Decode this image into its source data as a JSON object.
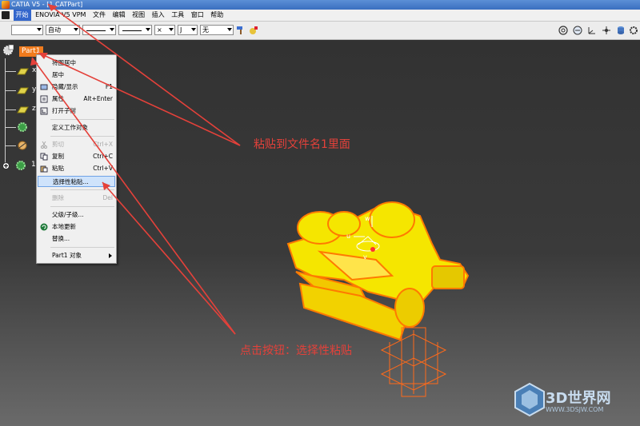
{
  "window": {
    "title": "CATIA V5 - [1.CATPart]"
  },
  "menubar": {
    "items": [
      {
        "label": "开始",
        "active": true
      },
      {
        "label": "ENOVIA V5 VPM"
      },
      {
        "label": "文件"
      },
      {
        "label": "编辑"
      },
      {
        "label": "视图"
      },
      {
        "label": "插入"
      },
      {
        "label": "工具"
      },
      {
        "label": "窗口"
      },
      {
        "label": "帮助"
      }
    ]
  },
  "toolbar": {
    "combo_auto": "自动",
    "combo_x": "×",
    "combo_j": "J",
    "combo_none": "无"
  },
  "tree": {
    "root_label": "Part1",
    "rows": [
      "x",
      "y",
      "z",
      "",
      "",
      "1"
    ]
  },
  "context_menu": {
    "items": [
      {
        "label": "将图居中",
        "shortcut": ""
      },
      {
        "label": "居中",
        "shortcut": ""
      },
      {
        "label": "隐藏/显示",
        "shortcut": "F1"
      },
      {
        "label": "属性",
        "shortcut": "Alt+Enter"
      },
      {
        "label": "打开子树",
        "shortcut": ""
      },
      {
        "label": "定义工作对象",
        "shortcut": ""
      },
      {
        "label": "剪切",
        "shortcut": "Ctrl+X",
        "disabled": true
      },
      {
        "label": "复制",
        "shortcut": "Ctrl+C"
      },
      {
        "label": "粘贴",
        "shortcut": "Ctrl+V"
      },
      {
        "label": "选择性粘贴...",
        "shortcut": "",
        "highlight": true
      },
      {
        "label": "删除",
        "shortcut": "Del",
        "disabled": true
      },
      {
        "label": "父级/子级...",
        "shortcut": ""
      },
      {
        "label": "本地更新",
        "shortcut": ""
      },
      {
        "label": "替换...",
        "shortcut": ""
      },
      {
        "label": "Part1 对象",
        "shortcut": ""
      }
    ]
  },
  "annotations": {
    "paste_into": "粘贴到文件名1里面",
    "click_button": "点击按钮：选择性粘贴"
  },
  "compass": {
    "w": "w",
    "u": "u",
    "v": "v"
  },
  "watermark": {
    "main": "3D世界网",
    "sub": "WWW.3DSJW.COM"
  },
  "colors": {
    "accent_orange": "#f07b1d",
    "annotation_red": "#e4413a",
    "model_yellow": "#f5e600",
    "model_edge": "#ff7a00"
  }
}
